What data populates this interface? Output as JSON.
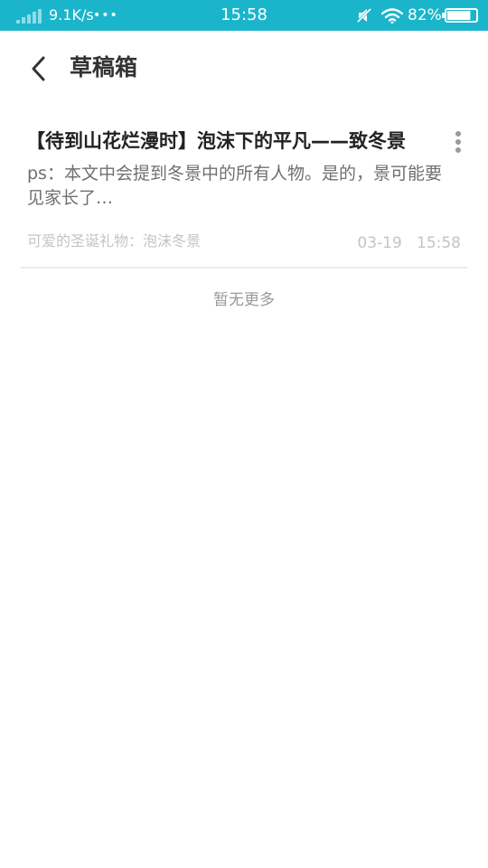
{
  "status_bar": {
    "net_speed": "9.1K/s",
    "net_dots": "•••",
    "time": "15:58",
    "battery_percent": "82%",
    "battery_level": 0.82,
    "background_color": "#1bb5cb",
    "icons": [
      "signal-icon",
      "mute-icon",
      "wifi-icon",
      "battery-icon"
    ]
  },
  "header": {
    "back_icon": "chevron-left-icon",
    "title": "草稿箱"
  },
  "drafts": [
    {
      "title": "【待到山花烂漫时】泡沫下的平凡——致冬景",
      "excerpt": "ps：本文中会提到冬景中的所有人物。是的，景可能要见家长了…",
      "category": "可爱的圣诞礼物：泡沫冬景",
      "date": "03-19",
      "time": "15:58",
      "menu_icon": "more-vertical-icon"
    }
  ],
  "footer": {
    "no_more_text": "暂无更多"
  }
}
